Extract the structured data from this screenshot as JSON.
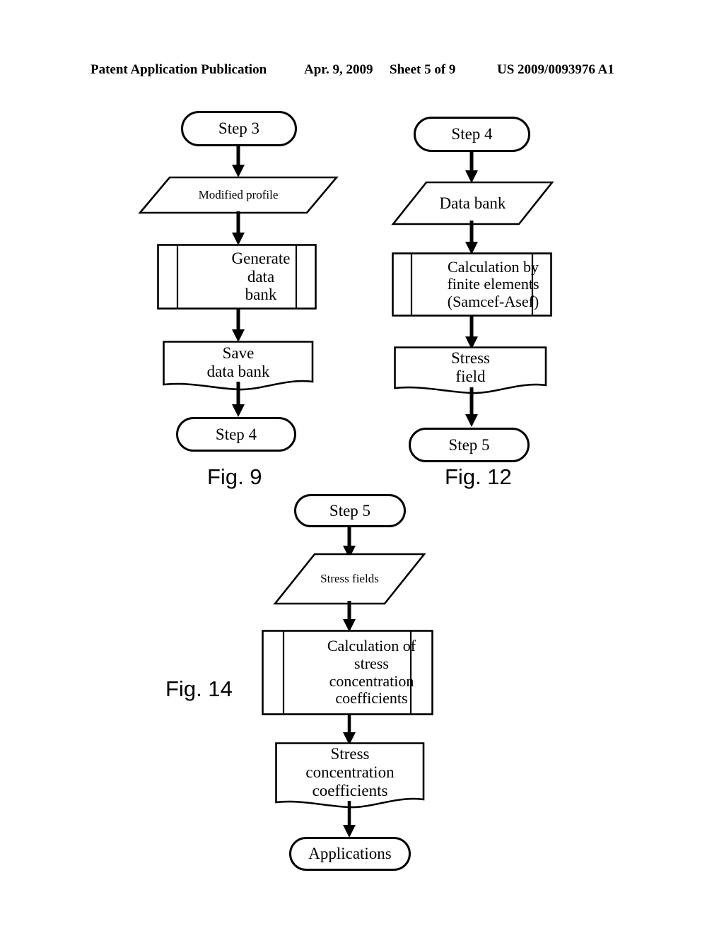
{
  "header": {
    "publication": "Patent Application Publication",
    "date": "Apr. 9, 2009",
    "sheet": "Sheet 5 of 9",
    "patent_number": "US 2009/0093976 A1"
  },
  "colors": {
    "ink": "#000000",
    "page": "#ffffff"
  },
  "figures": [
    {
      "id": "fig9",
      "caption": "Fig. 9",
      "nodes": [
        {
          "id": "fig9-start",
          "shape": "terminator",
          "text": "Step 3"
        },
        {
          "id": "fig9-input",
          "shape": "parallelogram",
          "text": "Modified profile"
        },
        {
          "id": "fig9-process",
          "shape": "predefined-process",
          "text": "Generate\ndata\nbank"
        },
        {
          "id": "fig9-document",
          "shape": "document",
          "text": "Save\ndata bank"
        },
        {
          "id": "fig9-end",
          "shape": "terminator",
          "text": "Step 4"
        }
      ],
      "connectors": [
        {
          "from": "fig9-start",
          "to": "fig9-input"
        },
        {
          "from": "fig9-input",
          "to": "fig9-process"
        },
        {
          "from": "fig9-process",
          "to": "fig9-document"
        },
        {
          "from": "fig9-document",
          "to": "fig9-end"
        }
      ]
    },
    {
      "id": "fig12",
      "caption": "Fig. 12",
      "nodes": [
        {
          "id": "fig12-start",
          "shape": "terminator",
          "text": "Step 4"
        },
        {
          "id": "fig12-input",
          "shape": "parallelogram",
          "text": "Data bank"
        },
        {
          "id": "fig12-process",
          "shape": "predefined-process",
          "text": "Calculation by\nfinite elements\n(Samcef-Asef)"
        },
        {
          "id": "fig12-document",
          "shape": "document",
          "text": "Stress\nfield"
        },
        {
          "id": "fig12-end",
          "shape": "terminator",
          "text": "Step 5"
        }
      ],
      "connectors": [
        {
          "from": "fig12-start",
          "to": "fig12-input"
        },
        {
          "from": "fig12-input",
          "to": "fig12-process"
        },
        {
          "from": "fig12-process",
          "to": "fig12-document"
        },
        {
          "from": "fig12-document",
          "to": "fig12-end"
        }
      ]
    },
    {
      "id": "fig14",
      "caption": "Fig. 14",
      "nodes": [
        {
          "id": "fig14-start",
          "shape": "terminator",
          "text": "Step 5"
        },
        {
          "id": "fig14-input",
          "shape": "parallelogram",
          "text": "Stress fields"
        },
        {
          "id": "fig14-process",
          "shape": "predefined-process",
          "text": "Calculation of\nstress\nconcentration\ncoefficients"
        },
        {
          "id": "fig14-document",
          "shape": "document",
          "text": "Stress\nconcentration\ncoefficients"
        },
        {
          "id": "fig14-end",
          "shape": "terminator",
          "text": "Applications"
        }
      ],
      "connectors": [
        {
          "from": "fig14-start",
          "to": "fig14-input"
        },
        {
          "from": "fig14-input",
          "to": "fig14-process"
        },
        {
          "from": "fig14-process",
          "to": "fig14-document"
        },
        {
          "from": "fig14-document",
          "to": "fig14-end"
        }
      ]
    }
  ]
}
